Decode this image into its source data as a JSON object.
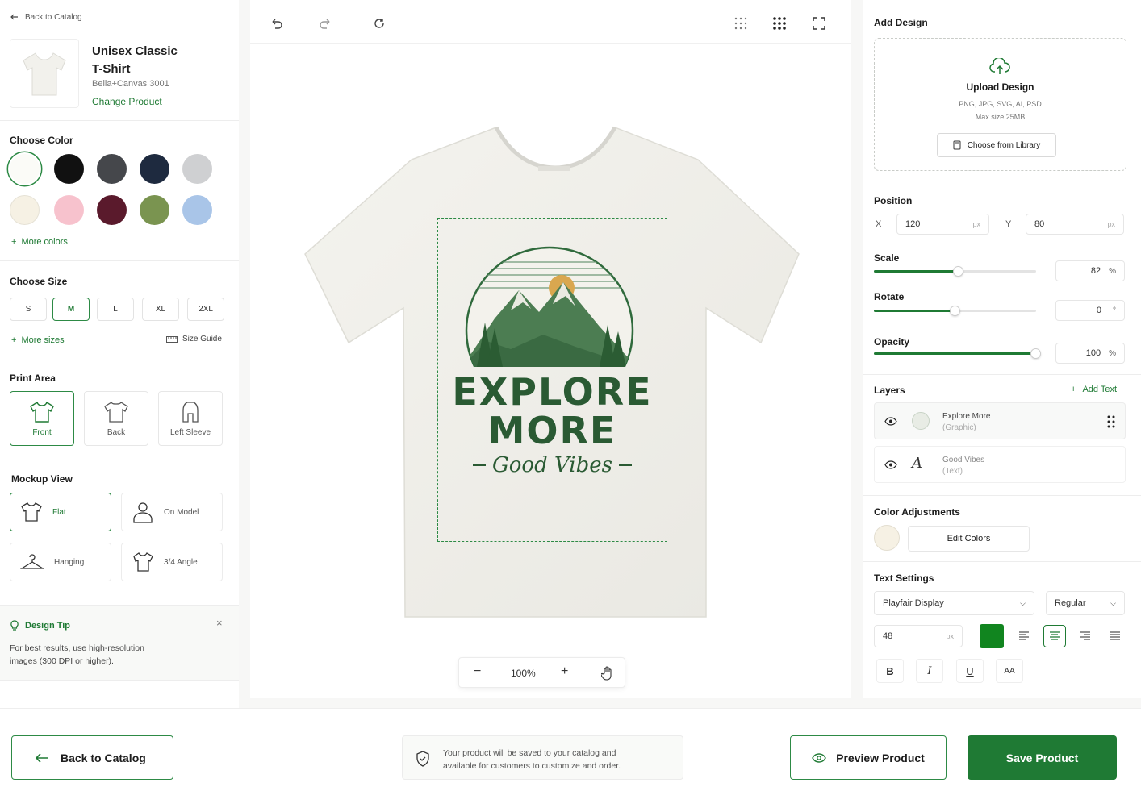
{
  "left": {
    "back_link": "Back to Catalog",
    "product": {
      "name_line1": "Unisex Classic",
      "name_line2": "T-Shirt",
      "brand": "Bella+Canvas 3001",
      "change": "Change Product"
    },
    "color_title": "Choose Color",
    "colors": [
      "#fbfbf7",
      "#111111",
      "#45474b",
      "#1e2a3f",
      "#cfd0d2",
      "#f6f1e4",
      "#f7c2cd",
      "#5a1a2c",
      "#7a9450",
      "#a9c5e8"
    ],
    "more_colors": "More colors",
    "size_title": "Choose Size",
    "sizes": [
      "S",
      "M",
      "L",
      "XL",
      "2XL"
    ],
    "selected_size": "M",
    "more_sizes": "More sizes",
    "size_guide": "Size Guide",
    "print_area_title": "Print Area",
    "print_areas": [
      "Front",
      "Back",
      "Left Sleeve"
    ],
    "mockup_title": "Mockup View",
    "mockups": [
      "Flat",
      "On Model",
      "Hanging",
      "3/4 Angle"
    ],
    "tip": {
      "title": "Design Tip",
      "line1": "For best results, use high-resolution",
      "line2": "images (300 DPI or higher)."
    }
  },
  "canvas": {
    "design": {
      "line1": "EXPLORE",
      "line2": "MORE",
      "script": "Good Vibes"
    },
    "zoom": "100%",
    "accent": "#1f7a34"
  },
  "right": {
    "add_design_title": "Add Design",
    "upload": {
      "title": "Upload Design",
      "formats": "PNG, JPG, SVG, AI, PSD",
      "max": "Max size 25MB",
      "library": "Choose from Library"
    },
    "position_title": "Position",
    "x_label": "X",
    "x_value": "120",
    "y_label": "Y",
    "y_value": "80",
    "unit": "px",
    "scale_title": "Scale",
    "scale_value": "82",
    "scale_unit": "%",
    "scale_level": 0.52,
    "rotate_title": "Rotate",
    "rotate_value": "0",
    "rotate_unit": "°",
    "rotate_level": 0.5,
    "opacity_title": "Opacity",
    "opacity_value": "100",
    "opacity_unit": "%",
    "opacity_level": 1.0,
    "layers_title": "Layers",
    "add_text": "Add Text",
    "layers": [
      {
        "name": "Explore More",
        "type": "(Graphic)"
      },
      {
        "name": "Good Vibes",
        "type": "(Text)"
      }
    ],
    "color_adj_title": "Color Adjustments",
    "edit_colors": "Edit Colors",
    "text_settings_title": "Text Settings",
    "font": "Playfair Display",
    "weight": "Regular",
    "font_size": "48",
    "font_size_unit": "px",
    "text_color": "#11851f",
    "bold": "B",
    "italic": "I",
    "underline": "U",
    "caps": "AA"
  },
  "bottom": {
    "back": "Back to Catalog",
    "notice_line1": "Your product will be saved to your catalog and",
    "notice_line2": "available for customers to customize and order.",
    "preview": "Preview Product",
    "save": "Save Product"
  }
}
